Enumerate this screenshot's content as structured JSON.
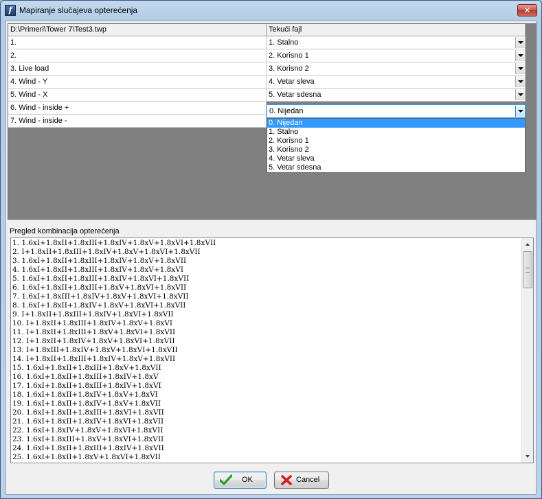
{
  "window": {
    "title": "Mapiranje slučajeva opterećenja",
    "close_symbol": "✕"
  },
  "grid": {
    "header": {
      "col1": "D:\\Primeri\\Tower 7\\Test3.twp",
      "col2": "Tekući fajl"
    },
    "rows": [
      {
        "name": "1.",
        "value": "1. Stalno"
      },
      {
        "name": "2.",
        "value": "2. Korisno 1"
      },
      {
        "name": "3. Live load",
        "value": "3. Korisno 2"
      },
      {
        "name": "4. Wind - Y",
        "value": "4. Vetar sleva"
      },
      {
        "name": "5. Wind - X",
        "value": "5. Vetar sdesna"
      },
      {
        "name": "6. Wind - inside +",
        "value": "0. Nijedan"
      },
      {
        "name": "7. Wind - inside -",
        "value": ""
      }
    ],
    "dropdown_options": [
      "0. Nijedan",
      "1. Stalno",
      "2. Korisno 1",
      "3. Korisno 2",
      "4. Vetar sleva",
      "5. Vetar sdesna"
    ],
    "dropdown_selected": "0. Nijedan"
  },
  "preview": {
    "label": "Pregled kombinacija opterećenja",
    "lines": [
      "1. 1.6xI+1.8xII+1.8xIII+1.8xIV+1.8xV+1.8xVI+1.8xVII",
      "2. I+1.8xII+1.8xIII+1.8xIV+1.8xV+1.8xVI+1.8xVII",
      "3. 1.6xI+1.8xII+1.8xIII+1.8xIV+1.8xV+1.8xVII",
      "4. 1.6xI+1.8xII+1.8xIII+1.8xIV+1.8xV+1.8xVI",
      "5. 1.6xI+1.8xII+1.8xIII+1.8xIV+1.8xVI+1.8xVII",
      "6. 1.6xI+1.8xII+1.8xIII+1.8xV+1.8xVI+1.8xVII",
      "7. 1.6xI+1.8xIII+1.8xIV+1.8xV+1.8xVI+1.8xVII",
      "8. 1.6xI+1.8xII+1.8xIV+1.8xV+1.8xVI+1.8xVII",
      "9. I+1.8xII+1.8xIII+1.8xIV+1.8xVI+1.8xVII",
      "10. I+1.8xII+1.8xIII+1.8xIV+1.8xV+1.8xVI",
      "11. I+1.8xII+1.8xIII+1.8xV+1.8xVI+1.8xVII",
      "12. I+1.8xII+1.8xIV+1.8xV+1.8xVI+1.8xVII",
      "13. I+1.8xIII+1.8xIV+1.8xV+1.8xVI+1.8xVII",
      "14. I+1.8xII+1.8xIII+1.8xIV+1.8xV+1.8xVII",
      "15. 1.6xI+1.8xII+1.8xIII+1.8xV+1.8xVII",
      "16. 1.6xI+1.8xII+1.8xIII+1.8xIV+1.8xV",
      "17. 1.6xI+1.8xII+1.8xIII+1.8xIV+1.8xVI",
      "18. 1.6xI+1.8xII+1.8xIV+1.8xV+1.8xVI",
      "19. 1.6xI+1.8xII+1.8xIV+1.8xV+1.8xVII",
      "20. 1.6xI+1.8xII+1.8xIII+1.8xVI+1.8xVII",
      "21. 1.6xI+1.8xII+1.8xIV+1.8xVI+1.8xVII",
      "22. 1.6xI+1.8xIV+1.8xV+1.8xVI+1.8xVII",
      "23. 1.6xI+1.8xIII+1.8xV+1.8xVI+1.8xVII",
      "24. 1.6xI+1.8xII+1.8xIII+1.8xIV+1.8xVII",
      "25. 1.6xI+1.8xII+1.8xV+1.8xVI+1.8xVII"
    ]
  },
  "buttons": {
    "ok": "OK",
    "cancel": "Cancel"
  },
  "colors": {
    "selection": "#3399ff",
    "grid_background": "#808080",
    "ok_icon": "#2e9a2e",
    "cancel_icon": "#d42020"
  },
  "icons": [
    "app-icon",
    "close-icon",
    "dropdown-arrow-icon",
    "scroll-up-icon",
    "scroll-down-icon",
    "checkmark-icon",
    "red-x-icon"
  ]
}
